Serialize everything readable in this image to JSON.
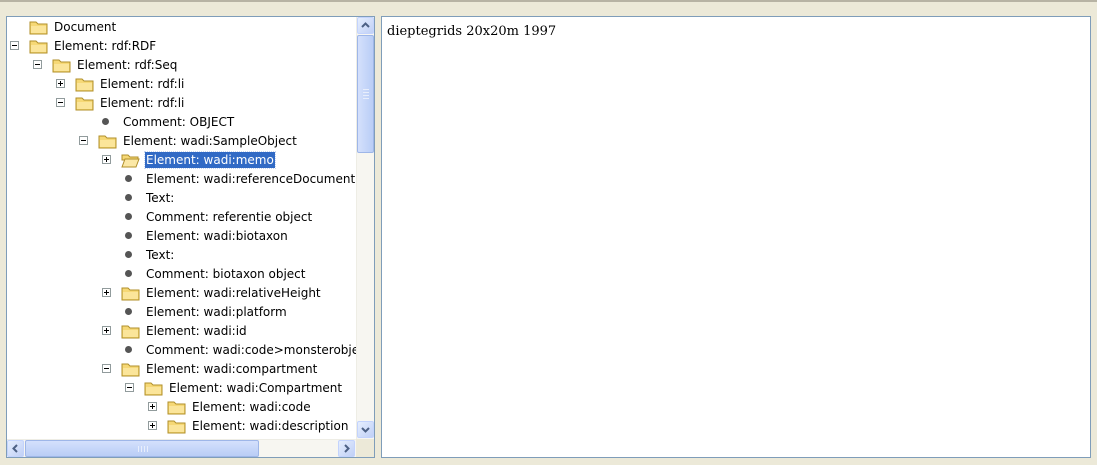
{
  "tree": {
    "nodes": [
      {
        "label": "Document",
        "kind": "folder",
        "expander": "none",
        "level": 0
      },
      {
        "label": "Element: rdf:RDF",
        "kind": "folder",
        "expander": "minus",
        "level": 0
      },
      {
        "label": "Element: rdf:Seq",
        "kind": "folder",
        "expander": "minus",
        "level": 1
      },
      {
        "label": "Element: rdf:li",
        "kind": "folder",
        "expander": "plus",
        "level": 2
      },
      {
        "label": "Element: rdf:li",
        "kind": "folder",
        "expander": "minus",
        "level": 2
      },
      {
        "label": "Comment: OBJECT",
        "kind": "leaf",
        "expander": "none",
        "level": 3
      },
      {
        "label": "Element: wadi:SampleObject",
        "kind": "folder",
        "expander": "minus",
        "level": 3
      },
      {
        "label": "Element: wadi:memo",
        "kind": "folder-open",
        "expander": "plus",
        "level": 4,
        "selected": true
      },
      {
        "label": "Element: wadi:referenceDocument",
        "kind": "leaf",
        "expander": "none",
        "level": 4
      },
      {
        "label": "Text:",
        "kind": "leaf",
        "expander": "none",
        "level": 4
      },
      {
        "label": "Comment: referentie object",
        "kind": "leaf",
        "expander": "none",
        "level": 4
      },
      {
        "label": "Element: wadi:biotaxon",
        "kind": "leaf",
        "expander": "none",
        "level": 4
      },
      {
        "label": "Text:",
        "kind": "leaf",
        "expander": "none",
        "level": 4
      },
      {
        "label": "Comment: biotaxon object",
        "kind": "leaf",
        "expander": "none",
        "level": 4
      },
      {
        "label": "Element: wadi:relativeHeight",
        "kind": "folder",
        "expander": "plus",
        "level": 4
      },
      {
        "label": "Element: wadi:platform",
        "kind": "leaf",
        "expander": "none",
        "level": 4
      },
      {
        "label": "Element: wadi:id",
        "kind": "folder",
        "expander": "plus",
        "level": 4
      },
      {
        "label": "Comment: wadi:code>monsterobject",
        "kind": "leaf",
        "expander": "none",
        "level": 4
      },
      {
        "label": "Element: wadi:compartment",
        "kind": "folder",
        "expander": "minus",
        "level": 4
      },
      {
        "label": "Element: wadi:Compartment",
        "kind": "folder",
        "expander": "minus",
        "level": 5
      },
      {
        "label": "Element: wadi:code",
        "kind": "folder",
        "expander": "plus",
        "level": 6
      },
      {
        "label": "Element: wadi:description",
        "kind": "folder",
        "expander": "plus",
        "level": 6
      }
    ]
  },
  "content": {
    "text": "dieptegrids 20x20m 1997"
  },
  "icons": {
    "folder": "folder-icon",
    "folder_open": "folder-open-icon",
    "leaf": "bullet-icon",
    "expand": "plus-icon",
    "collapse": "minus-icon"
  },
  "colors": {
    "selection": "#316ac5",
    "folder": "#f6d876",
    "pane_border": "#7f9db9",
    "window_bg": "#ece9d8"
  }
}
